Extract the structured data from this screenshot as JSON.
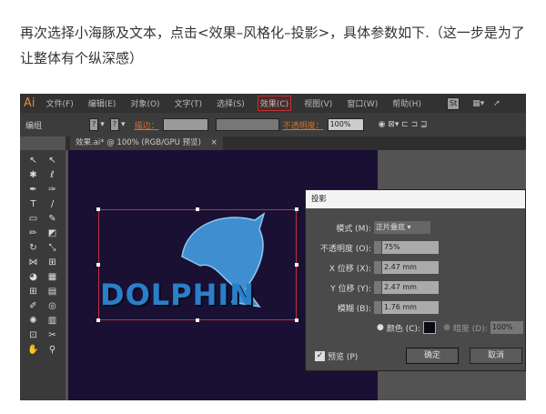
{
  "paragraph": "再次选择小海豚及文本，点击<效果–风格化–投影>，具体参数如下.（这一步是为了让整体有个纵深感）",
  "app": {
    "logo": "Ai",
    "menu": [
      "文件(F)",
      "编辑(E)",
      "对象(O)",
      "文字(T)",
      "选择(S)",
      "效果(C)",
      "视图(V)",
      "窗口(W)",
      "帮助(H)"
    ],
    "active_menu": "效果(C)",
    "st": "St"
  },
  "options": {
    "group": "编组",
    "q": "?",
    "stroke_label": "描边：",
    "opacity_label": "不透明度：",
    "opacity_value": "100%"
  },
  "tab": {
    "label": "效果.ai* @ 100% (RGB/GPU 预览)",
    "close": "×"
  },
  "canvas": {
    "logo_text": "DOLPHIN"
  },
  "dialog": {
    "title": "投影",
    "mode_label": "模式 (M):",
    "mode_value": "正片叠底",
    "opacity_label": "不透明度 (O):",
    "opacity_value": "75%",
    "x_label": "X 位移 (X):",
    "x_value": "2.47 mm",
    "y_label": "Y 位移 (Y):",
    "y_value": "2.47 mm",
    "blur_label": "模糊 (B):",
    "blur_value": "1.76 mm",
    "color_label": "颜色 (C):",
    "color": "#0a0a14",
    "darkness_label": "暗度 (D):",
    "darkness_value": "100%",
    "preview_label": "预览 (P)",
    "ok": "确定",
    "cancel": "取消"
  }
}
